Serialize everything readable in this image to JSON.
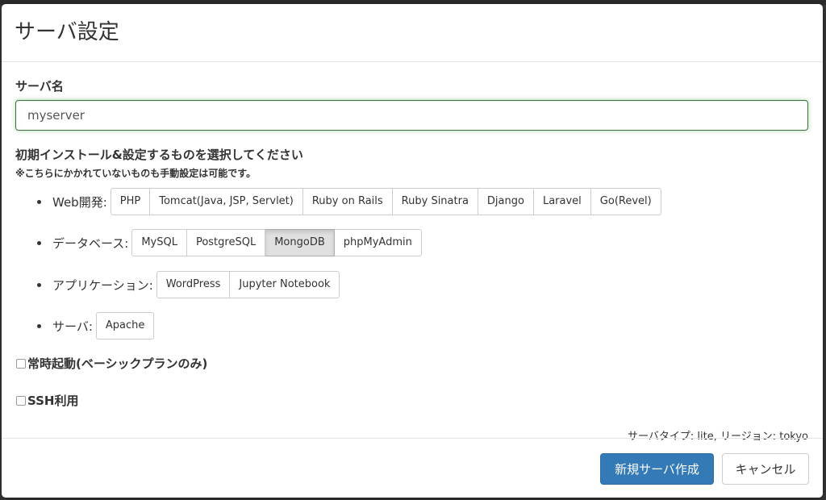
{
  "modal": {
    "title": "サーバ設定"
  },
  "server_name": {
    "label": "サーバ名",
    "value": "myserver"
  },
  "install": {
    "heading": "初期インストール&設定するものを選択してください",
    "note": "※こちらにかかれていないものも手動設定は可能です。",
    "groups": [
      {
        "label": "Web開発:",
        "options": [
          "PHP",
          "Tomcat(Java, JSP, Servlet)",
          "Ruby on Rails",
          "Ruby Sinatra",
          "Django",
          "Laravel",
          "Go(Revel)"
        ]
      },
      {
        "label": "データベース:",
        "options": [
          "MySQL",
          "PostgreSQL",
          "MongoDB",
          "phpMyAdmin"
        ],
        "selected": "MongoDB"
      },
      {
        "label": "アプリケーション:",
        "options": [
          "WordPress",
          "Jupyter Notebook"
        ]
      },
      {
        "label": "サーバ:",
        "options": [
          "Apache"
        ]
      }
    ]
  },
  "checkboxes": {
    "always_on": {
      "label": "常時起動(ベーシックプランのみ)",
      "checked": false
    },
    "ssh": {
      "label": "SSH利用",
      "checked": false
    }
  },
  "server_info": "サーバタイプ: lite, リージョン: tokyo",
  "footer": {
    "create_label": "新規サーバ作成",
    "cancel_label": "キャンセル"
  },
  "colors": {
    "primary": "#337ab7",
    "input_focus_border": "#3c763d",
    "active_option_bg": "#e0e0e0"
  }
}
